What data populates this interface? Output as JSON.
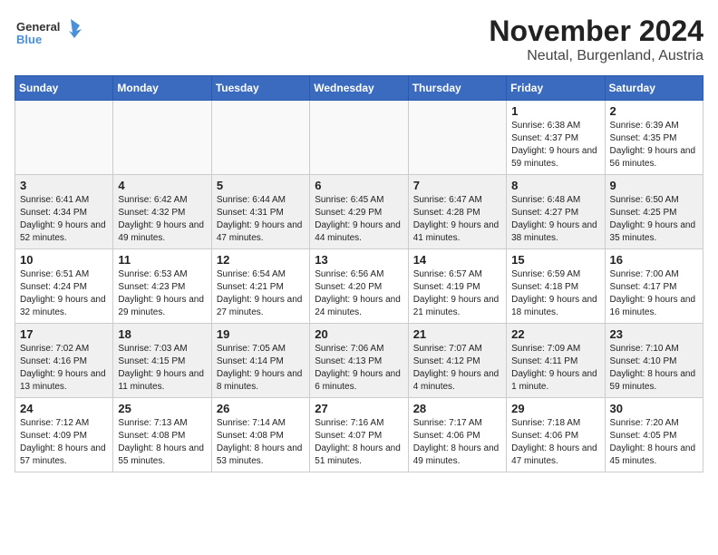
{
  "logo": {
    "line1": "General",
    "line2": "Blue"
  },
  "title": "November 2024",
  "subtitle": "Neutal, Burgenland, Austria",
  "days_of_week": [
    "Sunday",
    "Monday",
    "Tuesday",
    "Wednesday",
    "Thursday",
    "Friday",
    "Saturday"
  ],
  "weeks": [
    [
      {
        "day": "",
        "content": ""
      },
      {
        "day": "",
        "content": ""
      },
      {
        "day": "",
        "content": ""
      },
      {
        "day": "",
        "content": ""
      },
      {
        "day": "",
        "content": ""
      },
      {
        "day": "1",
        "content": "Sunrise: 6:38 AM\nSunset: 4:37 PM\nDaylight: 9 hours and 59 minutes."
      },
      {
        "day": "2",
        "content": "Sunrise: 6:39 AM\nSunset: 4:35 PM\nDaylight: 9 hours and 56 minutes."
      }
    ],
    [
      {
        "day": "3",
        "content": "Sunrise: 6:41 AM\nSunset: 4:34 PM\nDaylight: 9 hours and 52 minutes."
      },
      {
        "day": "4",
        "content": "Sunrise: 6:42 AM\nSunset: 4:32 PM\nDaylight: 9 hours and 49 minutes."
      },
      {
        "day": "5",
        "content": "Sunrise: 6:44 AM\nSunset: 4:31 PM\nDaylight: 9 hours and 47 minutes."
      },
      {
        "day": "6",
        "content": "Sunrise: 6:45 AM\nSunset: 4:29 PM\nDaylight: 9 hours and 44 minutes."
      },
      {
        "day": "7",
        "content": "Sunrise: 6:47 AM\nSunset: 4:28 PM\nDaylight: 9 hours and 41 minutes."
      },
      {
        "day": "8",
        "content": "Sunrise: 6:48 AM\nSunset: 4:27 PM\nDaylight: 9 hours and 38 minutes."
      },
      {
        "day": "9",
        "content": "Sunrise: 6:50 AM\nSunset: 4:25 PM\nDaylight: 9 hours and 35 minutes."
      }
    ],
    [
      {
        "day": "10",
        "content": "Sunrise: 6:51 AM\nSunset: 4:24 PM\nDaylight: 9 hours and 32 minutes."
      },
      {
        "day": "11",
        "content": "Sunrise: 6:53 AM\nSunset: 4:23 PM\nDaylight: 9 hours and 29 minutes."
      },
      {
        "day": "12",
        "content": "Sunrise: 6:54 AM\nSunset: 4:21 PM\nDaylight: 9 hours and 27 minutes."
      },
      {
        "day": "13",
        "content": "Sunrise: 6:56 AM\nSunset: 4:20 PM\nDaylight: 9 hours and 24 minutes."
      },
      {
        "day": "14",
        "content": "Sunrise: 6:57 AM\nSunset: 4:19 PM\nDaylight: 9 hours and 21 minutes."
      },
      {
        "day": "15",
        "content": "Sunrise: 6:59 AM\nSunset: 4:18 PM\nDaylight: 9 hours and 18 minutes."
      },
      {
        "day": "16",
        "content": "Sunrise: 7:00 AM\nSunset: 4:17 PM\nDaylight: 9 hours and 16 minutes."
      }
    ],
    [
      {
        "day": "17",
        "content": "Sunrise: 7:02 AM\nSunset: 4:16 PM\nDaylight: 9 hours and 13 minutes."
      },
      {
        "day": "18",
        "content": "Sunrise: 7:03 AM\nSunset: 4:15 PM\nDaylight: 9 hours and 11 minutes."
      },
      {
        "day": "19",
        "content": "Sunrise: 7:05 AM\nSunset: 4:14 PM\nDaylight: 9 hours and 8 minutes."
      },
      {
        "day": "20",
        "content": "Sunrise: 7:06 AM\nSunset: 4:13 PM\nDaylight: 9 hours and 6 minutes."
      },
      {
        "day": "21",
        "content": "Sunrise: 7:07 AM\nSunset: 4:12 PM\nDaylight: 9 hours and 4 minutes."
      },
      {
        "day": "22",
        "content": "Sunrise: 7:09 AM\nSunset: 4:11 PM\nDaylight: 9 hours and 1 minute."
      },
      {
        "day": "23",
        "content": "Sunrise: 7:10 AM\nSunset: 4:10 PM\nDaylight: 8 hours and 59 minutes."
      }
    ],
    [
      {
        "day": "24",
        "content": "Sunrise: 7:12 AM\nSunset: 4:09 PM\nDaylight: 8 hours and 57 minutes."
      },
      {
        "day": "25",
        "content": "Sunrise: 7:13 AM\nSunset: 4:08 PM\nDaylight: 8 hours and 55 minutes."
      },
      {
        "day": "26",
        "content": "Sunrise: 7:14 AM\nSunset: 4:08 PM\nDaylight: 8 hours and 53 minutes."
      },
      {
        "day": "27",
        "content": "Sunrise: 7:16 AM\nSunset: 4:07 PM\nDaylight: 8 hours and 51 minutes."
      },
      {
        "day": "28",
        "content": "Sunrise: 7:17 AM\nSunset: 4:06 PM\nDaylight: 8 hours and 49 minutes."
      },
      {
        "day": "29",
        "content": "Sunrise: 7:18 AM\nSunset: 4:06 PM\nDaylight: 8 hours and 47 minutes."
      },
      {
        "day": "30",
        "content": "Sunrise: 7:20 AM\nSunset: 4:05 PM\nDaylight: 8 hours and 45 minutes."
      }
    ]
  ]
}
